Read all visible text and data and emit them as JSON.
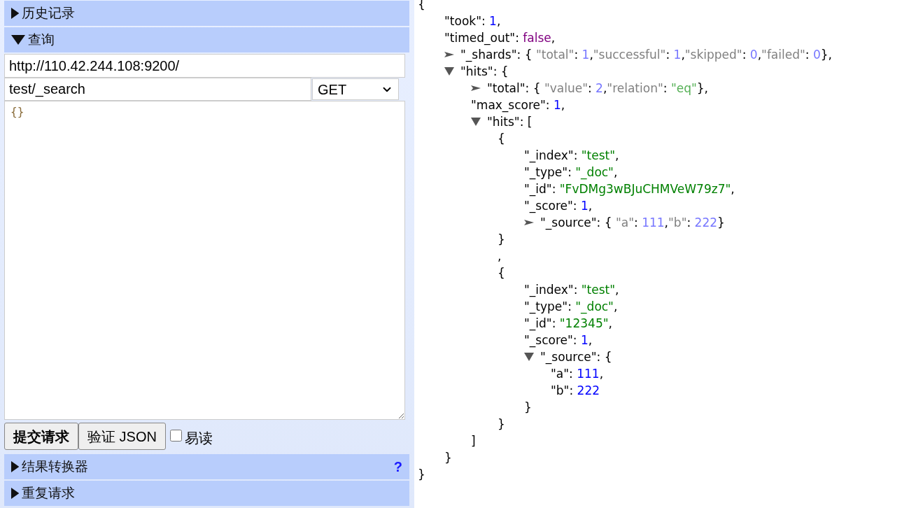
{
  "history_section": {
    "title": "历史记录",
    "expanded": false
  },
  "query_section": {
    "title": "查询",
    "expanded": true,
    "url": "http://110.42.244.108:9200/",
    "path": "test/_search",
    "method": "GET",
    "body": "{}",
    "buttons": [
      {
        "label": "提交请求",
        "kind": "primary"
      },
      {
        "label": "验证 JSON",
        "kind": "normal"
      }
    ],
    "readable": {
      "label": "易读",
      "checked": false
    }
  },
  "transformer_section": {
    "title": "结果转换器",
    "expanded": false,
    "help": "?"
  },
  "repeat_section": {
    "title": "重复请求",
    "expanded": false
  },
  "response": {
    "lines": [
      {
        "tokens": [
          {
            "kind": "punct",
            "text": "{"
          }
        ],
        "children": [
          {
            "tokens": [
              {
                "kind": "key",
                "text": "\"took\""
              },
              {
                "kind": "punct",
                "text": ": "
              },
              {
                "kind": "number",
                "text": "1"
              },
              {
                "kind": "punct",
                "text": ","
              }
            ]
          },
          {
            "tokens": [
              {
                "kind": "key",
                "text": "\"timed_out\""
              },
              {
                "kind": "punct",
                "text": ": "
              },
              {
                "kind": "boolean",
                "text": "false"
              },
              {
                "kind": "punct",
                "text": ","
              }
            ]
          },
          {
            "expanded": false,
            "tokens": [
              {
                "kind": "key",
                "text": "\"_shards\""
              },
              {
                "kind": "punct",
                "text": ": { "
              },
              {
                "kind": "dim_key",
                "text": "\"total\""
              },
              {
                "kind": "punct",
                "text": ": "
              },
              {
                "kind": "dim_number",
                "text": "1"
              },
              {
                "kind": "punct",
                "text": ","
              },
              {
                "kind": "dim_key",
                "text": "\"successful\""
              },
              {
                "kind": "punct",
                "text": ": "
              },
              {
                "kind": "dim_number",
                "text": "1"
              },
              {
                "kind": "punct",
                "text": ","
              },
              {
                "kind": "dim_key",
                "text": "\"skipped\""
              },
              {
                "kind": "punct",
                "text": ": "
              },
              {
                "kind": "dim_number",
                "text": "0"
              },
              {
                "kind": "punct",
                "text": ","
              },
              {
                "kind": "dim_key",
                "text": "\"failed\""
              },
              {
                "kind": "punct",
                "text": ": "
              },
              {
                "kind": "dim_number",
                "text": "0"
              },
              {
                "kind": "punct",
                "text": "},"
              }
            ]
          },
          {
            "expanded": true,
            "tokens": [
              {
                "kind": "key",
                "text": "\"hits\""
              },
              {
                "kind": "punct",
                "text": ": {"
              }
            ],
            "children": [
              {
                "expanded": false,
                "tokens": [
                  {
                    "kind": "key",
                    "text": "\"total\""
                  },
                  {
                    "kind": "punct",
                    "text": ": { "
                  },
                  {
                    "kind": "dim_key",
                    "text": "\"value\""
                  },
                  {
                    "kind": "punct",
                    "text": ": "
                  },
                  {
                    "kind": "dim_number",
                    "text": "2"
                  },
                  {
                    "kind": "punct",
                    "text": ","
                  },
                  {
                    "kind": "dim_key",
                    "text": "\"relation\""
                  },
                  {
                    "kind": "punct",
                    "text": ": "
                  },
                  {
                    "kind": "dim_string",
                    "text": "\"eq\""
                  },
                  {
                    "kind": "punct",
                    "text": "},"
                  }
                ]
              },
              {
                "tokens": [
                  {
                    "kind": "key",
                    "text": "\"max_score\""
                  },
                  {
                    "kind": "punct",
                    "text": ": "
                  },
                  {
                    "kind": "number",
                    "text": "1"
                  },
                  {
                    "kind": "punct",
                    "text": ","
                  }
                ]
              },
              {
                "expanded": true,
                "tokens": [
                  {
                    "kind": "key",
                    "text": "\"hits\""
                  },
                  {
                    "kind": "punct",
                    "text": ": ["
                  }
                ],
                "children": [
                  {
                    "tokens": [
                      {
                        "kind": "punct",
                        "text": "{"
                      }
                    ],
                    "children": [
                      {
                        "tokens": [
                          {
                            "kind": "key",
                            "text": "\"_index\""
                          },
                          {
                            "kind": "punct",
                            "text": ": "
                          },
                          {
                            "kind": "string",
                            "text": "\"test\""
                          },
                          {
                            "kind": "punct",
                            "text": ","
                          }
                        ]
                      },
                      {
                        "tokens": [
                          {
                            "kind": "key",
                            "text": "\"_type\""
                          },
                          {
                            "kind": "punct",
                            "text": ": "
                          },
                          {
                            "kind": "string",
                            "text": "\"_doc\""
                          },
                          {
                            "kind": "punct",
                            "text": ","
                          }
                        ]
                      },
                      {
                        "tokens": [
                          {
                            "kind": "key",
                            "text": "\"_id\""
                          },
                          {
                            "kind": "punct",
                            "text": ": "
                          },
                          {
                            "kind": "string",
                            "text": "\"FvDMg3wBJuCHMVeW79z7\""
                          },
                          {
                            "kind": "punct",
                            "text": ","
                          }
                        ]
                      },
                      {
                        "tokens": [
                          {
                            "kind": "key",
                            "text": "\"_score\""
                          },
                          {
                            "kind": "punct",
                            "text": ": "
                          },
                          {
                            "kind": "number",
                            "text": "1"
                          },
                          {
                            "kind": "punct",
                            "text": ","
                          }
                        ]
                      },
                      {
                        "expanded": false,
                        "tokens": [
                          {
                            "kind": "key",
                            "text": "\"_source\""
                          },
                          {
                            "kind": "punct",
                            "text": ": { "
                          },
                          {
                            "kind": "dim_key",
                            "text": "\"a\""
                          },
                          {
                            "kind": "punct",
                            "text": ": "
                          },
                          {
                            "kind": "dim_number",
                            "text": "111"
                          },
                          {
                            "kind": "punct",
                            "text": ","
                          },
                          {
                            "kind": "dim_key",
                            "text": "\"b\""
                          },
                          {
                            "kind": "punct",
                            "text": ": "
                          },
                          {
                            "kind": "dim_number",
                            "text": "222"
                          },
                          {
                            "kind": "punct",
                            "text": "}"
                          }
                        ]
                      }
                    ],
                    "close": "}"
                  },
                  {
                    "tokens": [
                      {
                        "kind": "punct",
                        "text": ","
                      }
                    ]
                  },
                  {
                    "tokens": [
                      {
                        "kind": "punct",
                        "text": "{"
                      }
                    ],
                    "children": [
                      {
                        "tokens": [
                          {
                            "kind": "key",
                            "text": "\"_index\""
                          },
                          {
                            "kind": "punct",
                            "text": ": "
                          },
                          {
                            "kind": "string",
                            "text": "\"test\""
                          },
                          {
                            "kind": "punct",
                            "text": ","
                          }
                        ]
                      },
                      {
                        "tokens": [
                          {
                            "kind": "key",
                            "text": "\"_type\""
                          },
                          {
                            "kind": "punct",
                            "text": ": "
                          },
                          {
                            "kind": "string",
                            "text": "\"_doc\""
                          },
                          {
                            "kind": "punct",
                            "text": ","
                          }
                        ]
                      },
                      {
                        "tokens": [
                          {
                            "kind": "key",
                            "text": "\"_id\""
                          },
                          {
                            "kind": "punct",
                            "text": ": "
                          },
                          {
                            "kind": "string",
                            "text": "\"12345\""
                          },
                          {
                            "kind": "punct",
                            "text": ","
                          }
                        ]
                      },
                      {
                        "tokens": [
                          {
                            "kind": "key",
                            "text": "\"_score\""
                          },
                          {
                            "kind": "punct",
                            "text": ": "
                          },
                          {
                            "kind": "number",
                            "text": "1"
                          },
                          {
                            "kind": "punct",
                            "text": ","
                          }
                        ]
                      },
                      {
                        "expanded": true,
                        "tokens": [
                          {
                            "kind": "key",
                            "text": "\"_source\""
                          },
                          {
                            "kind": "punct",
                            "text": ": {"
                          }
                        ],
                        "children": [
                          {
                            "tokens": [
                              {
                                "kind": "key",
                                "text": "\"a\""
                              },
                              {
                                "kind": "punct",
                                "text": ": "
                              },
                              {
                                "kind": "number",
                                "text": "111"
                              },
                              {
                                "kind": "punct",
                                "text": ","
                              }
                            ]
                          },
                          {
                            "tokens": [
                              {
                                "kind": "key",
                                "text": "\"b\""
                              },
                              {
                                "kind": "punct",
                                "text": ": "
                              },
                              {
                                "kind": "number",
                                "text": "222"
                              }
                            ]
                          }
                        ],
                        "close": "}"
                      }
                    ],
                    "close": "}"
                  }
                ],
                "close": "]"
              }
            ],
            "close": "}"
          }
        ],
        "close": "}"
      }
    ]
  }
}
